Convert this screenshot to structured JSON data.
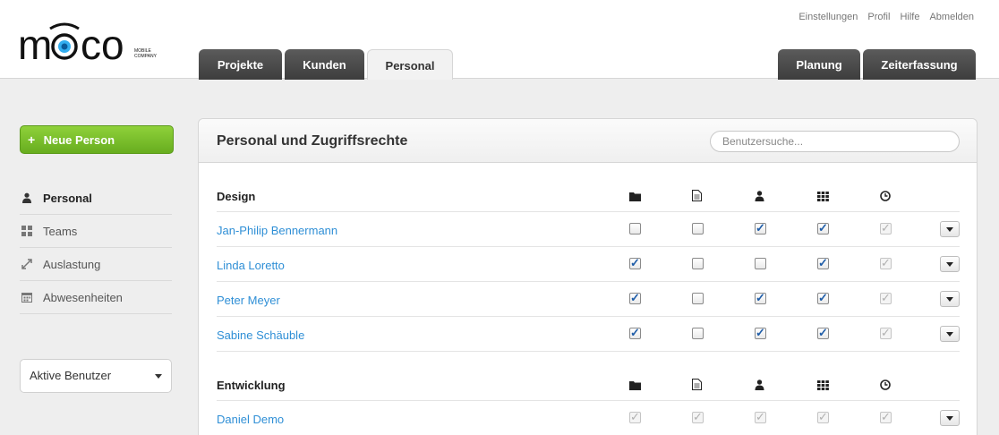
{
  "logo": {
    "text": "m  co",
    "subtitle": "MOBILE COMPANY"
  },
  "toplinks": [
    "Einstellungen",
    "Profil",
    "Hilfe",
    "Abmelden"
  ],
  "tabs_left": [
    "Projekte",
    "Kunden",
    "Personal"
  ],
  "tabs_right": [
    "Planung",
    "Zeiterfassung"
  ],
  "active_tab": "Personal",
  "sidebar": {
    "new_button": "Neue Person",
    "items": [
      {
        "label": "Personal",
        "icon": "person-icon",
        "active": true
      },
      {
        "label": "Teams",
        "icon": "grid-icon",
        "active": false
      },
      {
        "label": "Auslastung",
        "icon": "expand-arrows-icon",
        "active": false
      },
      {
        "label": "Abwesenheiten",
        "icon": "calendar-icon",
        "active": false
      }
    ],
    "filter": {
      "selected": "Aktive Benutzer"
    }
  },
  "panel": {
    "title": "Personal und Zugriffsrechte",
    "search_placeholder": "Benutzersuche...",
    "column_icons": [
      "folder-icon",
      "document-icon",
      "person-icon",
      "grid-icon",
      "clock-icon"
    ],
    "groups": [
      {
        "name": "Design",
        "people": [
          {
            "name": "Jan-Philip Bennermann",
            "perms": [
              "off",
              "off",
              "on",
              "on",
              "disabled"
            ]
          },
          {
            "name": "Linda Loretto",
            "perms": [
              "on",
              "off",
              "off",
              "on",
              "disabled"
            ]
          },
          {
            "name": "Peter Meyer",
            "perms": [
              "on",
              "off",
              "on",
              "on",
              "disabled"
            ]
          },
          {
            "name": "Sabine Schäuble",
            "perms": [
              "on",
              "off",
              "on",
              "on",
              "disabled"
            ]
          }
        ]
      },
      {
        "name": "Entwicklung",
        "people": [
          {
            "name": "Daniel Demo",
            "perms": [
              "disabled",
              "disabled",
              "disabled",
              "disabled",
              "disabled"
            ]
          }
        ]
      }
    ]
  },
  "colors": {
    "accent_green": "#7bc02b",
    "link_blue": "#2f8fd6",
    "tab_dark": "#4a4a4a"
  }
}
